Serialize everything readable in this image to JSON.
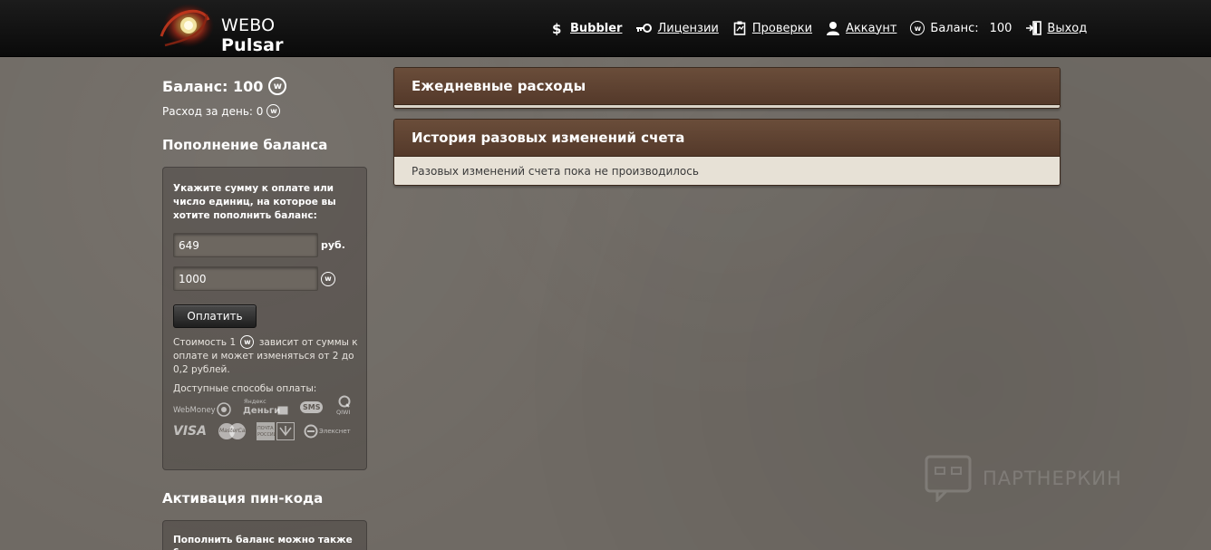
{
  "header": {
    "logo": {
      "brand": "WEBO",
      "product": "Pulsar"
    },
    "nav": [
      {
        "label": "Bubbler",
        "icon": "dollar-icon"
      },
      {
        "label": "Лицензии",
        "icon": "key-icon"
      },
      {
        "label": "Проверки",
        "icon": "clipboard-icon"
      },
      {
        "label": "Аккаунт",
        "icon": "user-icon"
      },
      {
        "label": "Баланс:",
        "value": "100",
        "icon": "webo-coin-icon"
      },
      {
        "label": "Выход",
        "icon": "exit-icon"
      }
    ]
  },
  "sidebar": {
    "balance_label": "Баланс: 100",
    "spend_label": "Расход за день: 0",
    "coin_symbol": "w",
    "topup": {
      "title": "Пополнение баланса",
      "description": "Укажите сумму к оплате или число единиц, на которое вы хотите пополнить баланс:",
      "rub_value": "649",
      "rub_unit": "руб.",
      "units_value": "1000",
      "pay_button": "Оплатить",
      "cost_note_1": "Стоимость 1",
      "cost_note_2": "зависит от суммы к оплате и может изменяться от 2 до 0,2 рублей.",
      "methods_label": "Доступные способы оплаты:",
      "methods": {
        "webmoney": "WebMoney",
        "yandex_top": "Яндекс",
        "yandex_bottom": "Деньги",
        "sms": "SMS",
        "qiwi": "QIWI",
        "visa": "VISA",
        "mastercard": "MasterCard",
        "post_top": "ПОЧТА",
        "post_bottom": "РОССИИ",
        "eleksnet": "Элекснет"
      }
    },
    "pin": {
      "title": "Активация пин-кода",
      "description": "Пополнить баланс можно также с"
    }
  },
  "main": {
    "daily_panel": {
      "title": "Ежедневные расходы"
    },
    "history_panel": {
      "title": "История разовых изменений счета",
      "empty_text": "Разовых изменений счета пока не производилось"
    }
  },
  "watermark": {
    "text": "ПАРТНЕРКИН"
  },
  "colors": {
    "page_bg": "#6f6a64",
    "header_bg": "#111111",
    "panel_header": "#5e4231",
    "panel_body": "#e7e1d6"
  }
}
